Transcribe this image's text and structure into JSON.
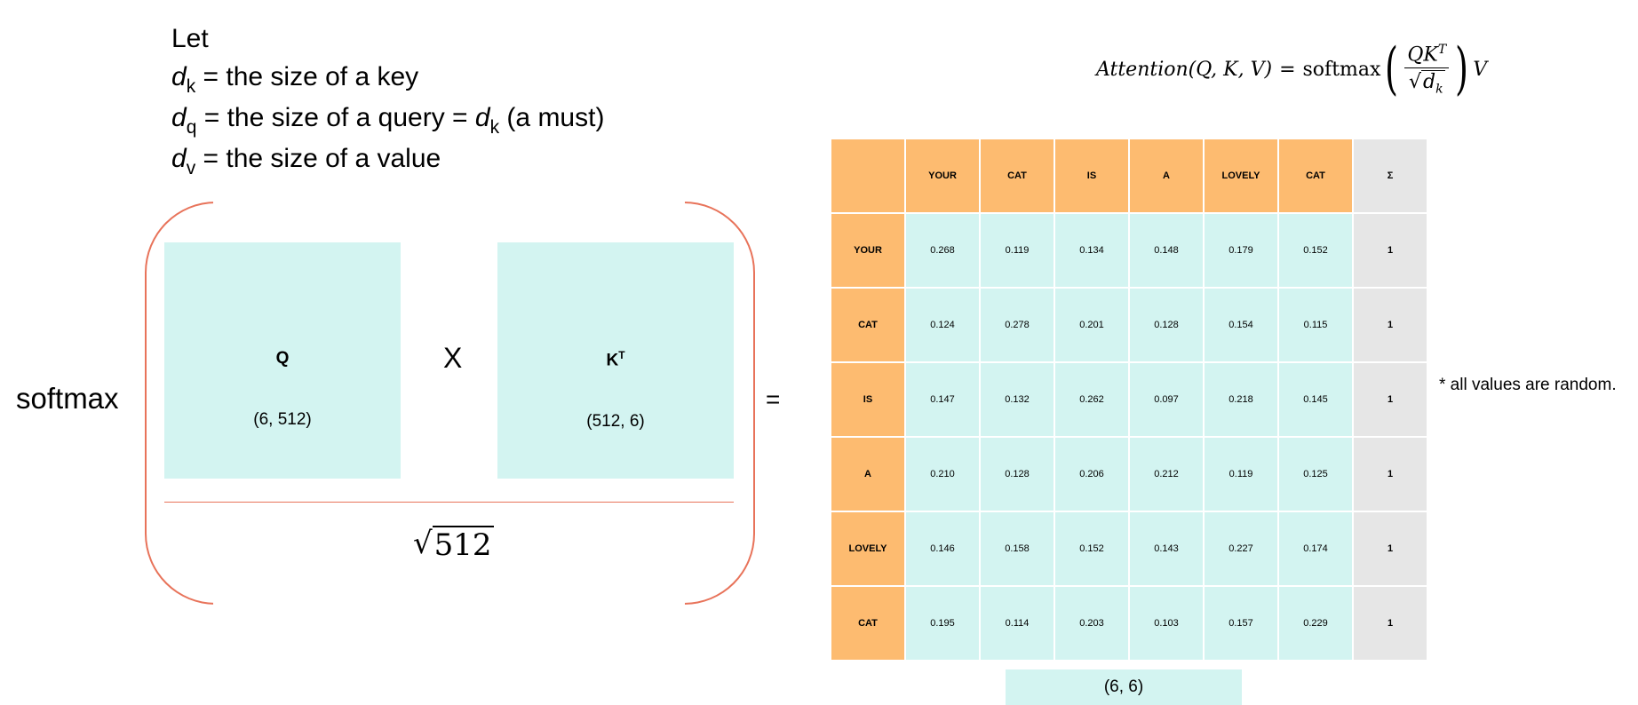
{
  "definitions": {
    "let": "Let",
    "lines": [
      {
        "var": "d",
        "sub": "k",
        "text": " = the size of a key"
      },
      {
        "var": "d",
        "sub": "q",
        "text": " = the size of a query = ",
        "var2": "d",
        "sub2": "k",
        "tail": " (a must)"
      },
      {
        "var": "d",
        "sub": "v",
        "text": " = the size of a value"
      }
    ]
  },
  "formula": {
    "lhs": "Attention(Q, K, V)",
    "equals": "=",
    "fn": "softmax",
    "numerator": "QK",
    "numerator_sup": "T",
    "denominator_radicand": "d",
    "denominator_sub": "k",
    "tail": "V"
  },
  "softmax_label": "softmax",
  "q_matrix": {
    "name": "Q",
    "dims": "(6, 512)"
  },
  "times": "X",
  "k_matrix": {
    "name": "K",
    "name_sup": "T",
    "dims": "(512,  6)"
  },
  "sqrt_radicand": "512",
  "equals": "=",
  "table": {
    "columns": [
      "YOUR",
      "CAT",
      "IS",
      "A",
      "LOVELY",
      "CAT"
    ],
    "sum_header": "Σ",
    "rows": [
      {
        "label": "YOUR",
        "values": [
          "0.268",
          "0.119",
          "0.134",
          "0.148",
          "0.179",
          "0.152"
        ],
        "sum": "1"
      },
      {
        "label": "CAT",
        "values": [
          "0.124",
          "0.278",
          "0.201",
          "0.128",
          "0.154",
          "0.115"
        ],
        "sum": "1"
      },
      {
        "label": "IS",
        "values": [
          "0.147",
          "0.132",
          "0.262",
          "0.097",
          "0.218",
          "0.145"
        ],
        "sum": "1"
      },
      {
        "label": "A",
        "values": [
          "0.210",
          "0.128",
          "0.206",
          "0.212",
          "0.119",
          "0.125"
        ],
        "sum": "1"
      },
      {
        "label": "LOVELY",
        "values": [
          "0.146",
          "0.158",
          "0.152",
          "0.143",
          "0.227",
          "0.174"
        ],
        "sum": "1"
      },
      {
        "label": "CAT",
        "values": [
          "0.195",
          "0.114",
          "0.203",
          "0.103",
          "0.157",
          "0.229"
        ],
        "sum": "1"
      }
    ]
  },
  "result_dims": "(6, 6)",
  "note": "* all values are random.",
  "colors": {
    "header": "#fdbb70",
    "cell": "#d3f4f1",
    "sum": "#e6e6e6",
    "bracket": "#e8735a"
  }
}
